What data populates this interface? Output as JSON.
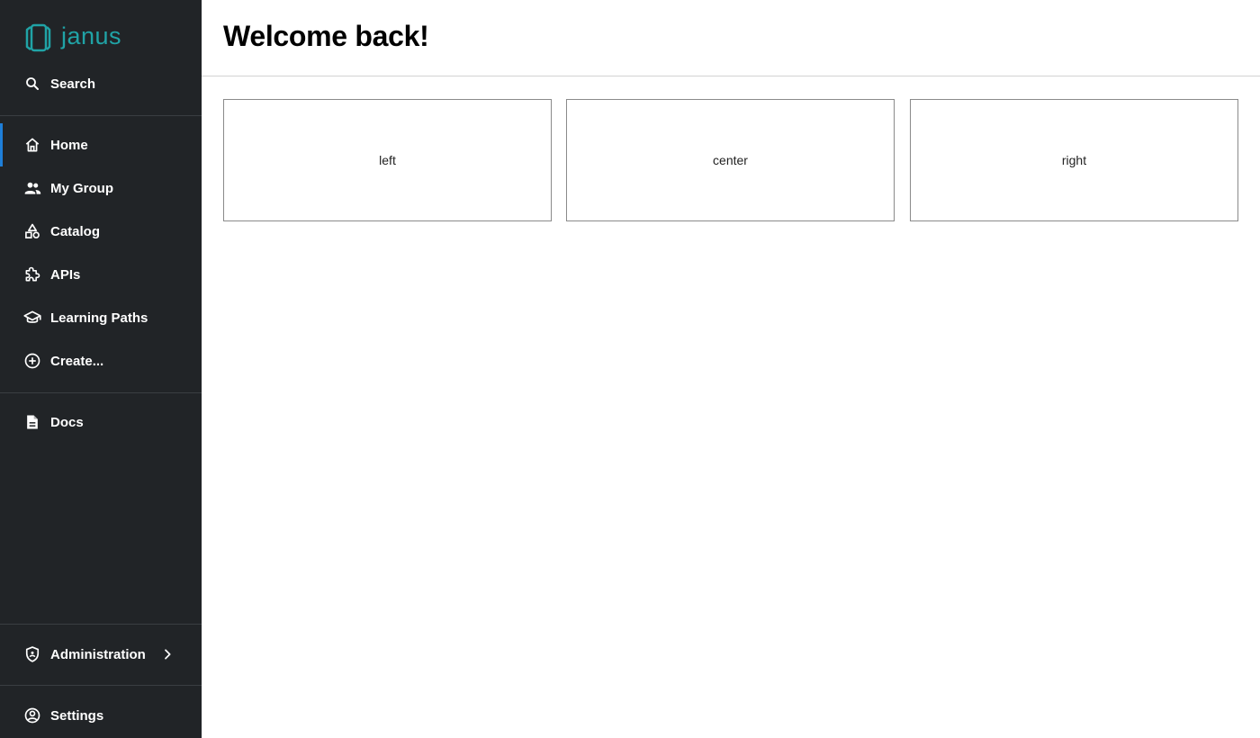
{
  "app": {
    "logo_text": "janus"
  },
  "sidebar": {
    "search_label": "Search",
    "items": [
      {
        "label": "Home"
      },
      {
        "label": "My Group"
      },
      {
        "label": "Catalog"
      },
      {
        "label": "APIs"
      },
      {
        "label": "Learning Paths"
      },
      {
        "label": "Create..."
      },
      {
        "label": "Docs"
      }
    ],
    "admin_label": "Administration",
    "settings_label": "Settings"
  },
  "main": {
    "title": "Welcome back!",
    "panels": [
      {
        "label": "left"
      },
      {
        "label": "center"
      },
      {
        "label": "right"
      }
    ]
  },
  "colors": {
    "sidebar_bg": "#212427",
    "accent": "#1e7fd9",
    "brand": "#20a3a6"
  }
}
